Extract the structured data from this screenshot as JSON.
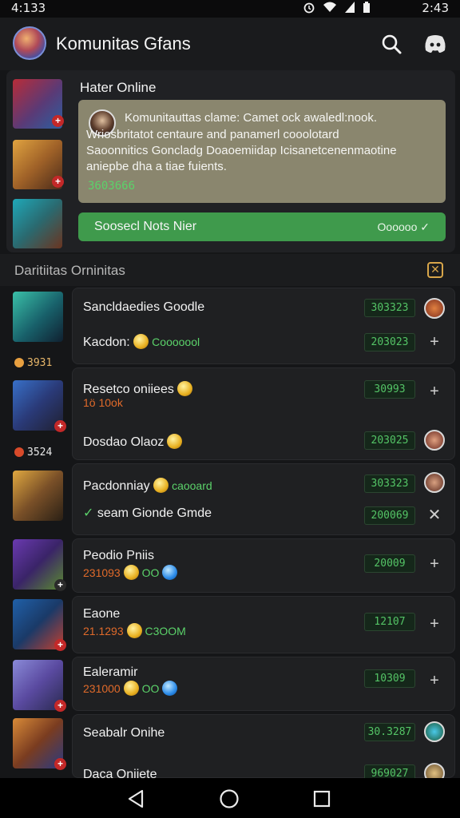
{
  "status_bar": {
    "time_left": "4:133",
    "time_right": "2:43",
    "icons": [
      "alarm-icon",
      "wifi-icon",
      "signal-icon",
      "battery-icon"
    ]
  },
  "app_bar": {
    "title": "Komunitas Gfans",
    "actions": [
      "search-icon",
      "discord-icon"
    ]
  },
  "feature": {
    "title": "Hater Online",
    "notice": {
      "line1": "Komunitauttas clame: Camet ock awaledl:nook.",
      "line2": "Wriosbritatot centaure and panamerl cooolotard",
      "line3": "Saoonnitics Goncladg Doaoemiidap Icisanetcenenmaotine",
      "line4": "aniepbe dha a tiae fuients.",
      "count": "3603666"
    },
    "status_button": {
      "label": "Soosecl Nots Nier",
      "value": "Oooooo ✓"
    }
  },
  "section": {
    "title": "Daritiitas Orninitas",
    "close_icon": "close-box-icon"
  },
  "left_stats": [
    {
      "value": "3931",
      "color": "#e8b76a"
    },
    {
      "value": "3524",
      "color": "#e9e9e9"
    }
  ],
  "rows": [
    {
      "name": "Sancldaedies Goodle",
      "score": "303323",
      "action": "avatar"
    },
    {
      "name": "Kacdon:",
      "sub": "Cooooool",
      "score": "203023",
      "action": "+"
    },
    {
      "name": "Resetco oniiees",
      "sub": "1ö 10ok",
      "score": "30993",
      "action": "+"
    },
    {
      "name": "Dosdao Olaoz",
      "score": "203025",
      "action": "avatar"
    },
    {
      "name": "Pacdonniay",
      "sub": "caooard",
      "score": "303323",
      "action": "avatar"
    },
    {
      "name": "seam Gionde Gmde",
      "score": "200069",
      "action": "✕"
    },
    {
      "name": "Peodio Pniis",
      "sub": "231093",
      "sub2": "OO",
      "score": "20009",
      "action": "+"
    },
    {
      "name": "Eaone",
      "sub": "21.1293",
      "sub2": "C3OOM",
      "score": "12107",
      "action": "+"
    },
    {
      "name": "Ealeramir",
      "sub": "231000",
      "sub2": "OO",
      "score": "10309",
      "action": "+"
    },
    {
      "name": "Seabalr Onihe",
      "score": "30.3287",
      "action": "avatar"
    },
    {
      "name": "Daca Oniiete",
      "score": "969027",
      "action": "avatar"
    }
  ],
  "nav_bar": [
    "back-icon",
    "home-icon",
    "recents-icon"
  ],
  "colors": {
    "background": "#151618",
    "accent_green": "#3f9a4c",
    "score_green": "#54c466",
    "notice_bg": "#8a866e",
    "warn": "#d8a64a"
  }
}
